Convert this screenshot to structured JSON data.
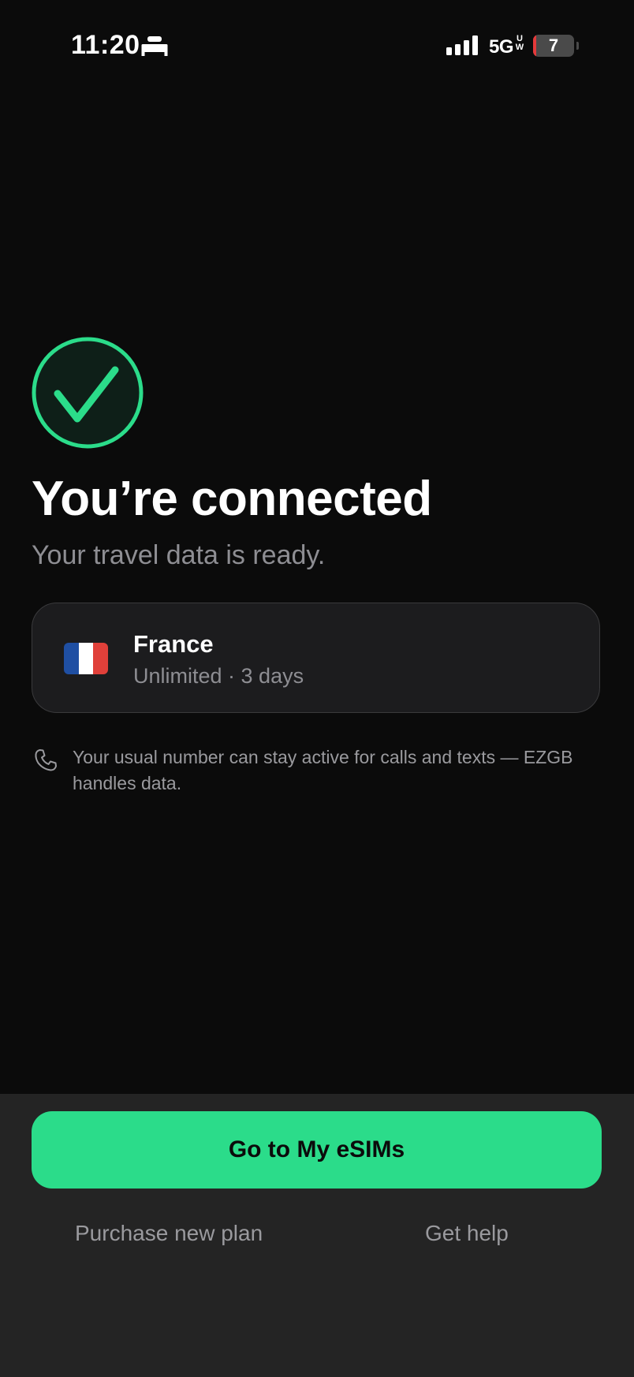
{
  "status_bar": {
    "time": "11:20",
    "sleep_icon": "bed-icon",
    "signal_icon": "cellular-signal-icon",
    "network": "5G",
    "network_superscript": "U W",
    "battery_level": "7",
    "battery_fraction": 0.07,
    "battery_color": "#e5393a"
  },
  "success": {
    "icon": "checkmark-circle-icon",
    "accent": "#2bdc8a",
    "title": "You’re connected",
    "subtitle": "Your travel data is ready."
  },
  "plan": {
    "flag_icon": "france-flag-icon",
    "flag_colors": [
      "#1f4fa3",
      "#ffffff",
      "#e0403a"
    ],
    "country": "France",
    "details": "Unlimited · 3 days"
  },
  "info": {
    "icon": "phone-icon",
    "text": "Your usual number can stay active for calls and texts — EZGB handles data."
  },
  "actions": {
    "primary_label": "Go to My eSIMs",
    "purchase_label": "Purchase new plan",
    "help_label": "Get help"
  },
  "colors": {
    "background": "#0b0b0b",
    "card": "#1c1c1e",
    "sheet": "#242424",
    "muted_text": "#8e8e93",
    "accent": "#2bdc8a"
  }
}
